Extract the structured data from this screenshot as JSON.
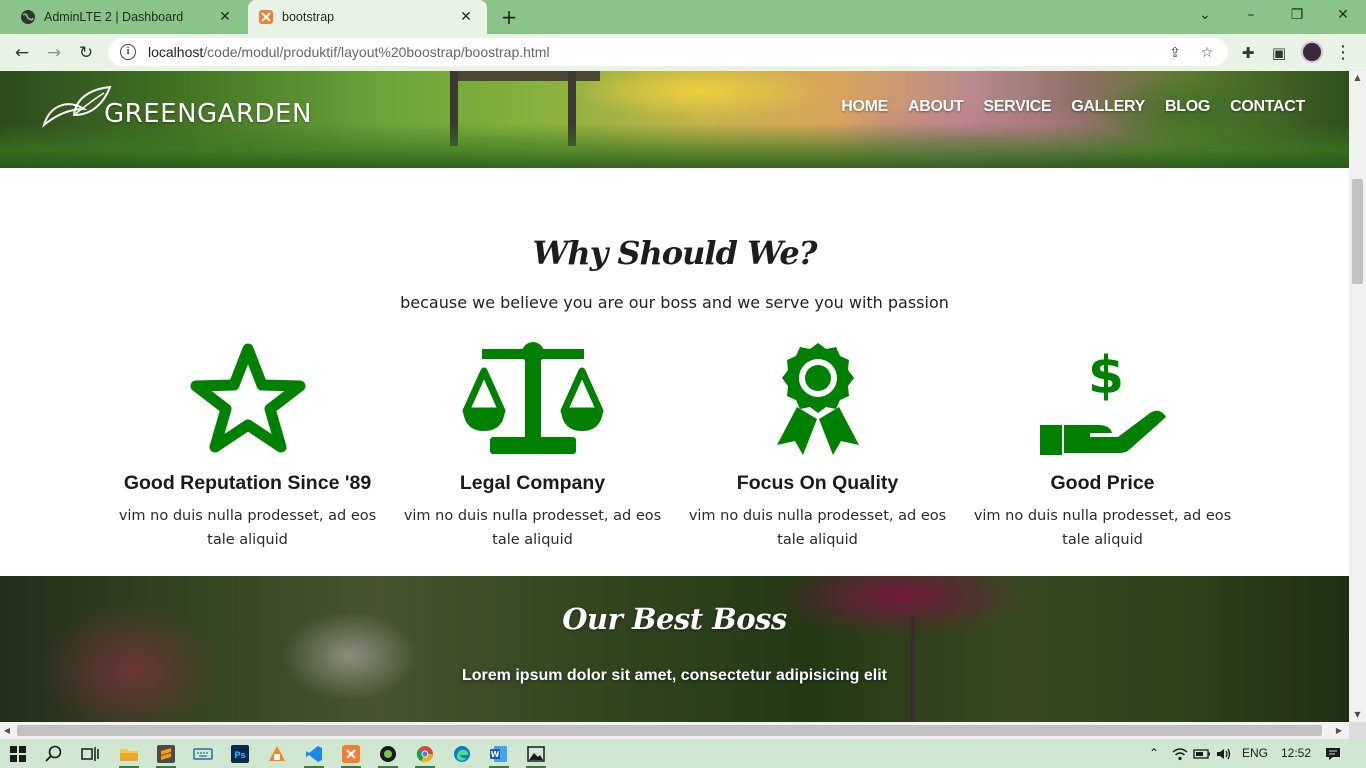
{
  "browser": {
    "tabs": [
      {
        "title": "AdminLTE 2 | Dashboard",
        "icon": "globe-icon",
        "active": false
      },
      {
        "title": "bootstrap",
        "icon": "xampp-icon",
        "active": true
      }
    ],
    "url_host": "localhost",
    "url_path": "/code/modul/produktif/layout%20boostrap/boostrap.html"
  },
  "site": {
    "brand": "GREENGARDEN",
    "nav": [
      "HOME",
      "ABOUT",
      "SERVICE",
      "GALLERY",
      "BLOG",
      "CONTACT"
    ]
  },
  "why": {
    "title": "Why Should We?",
    "subtitle": "because we believe you are our boss and we serve you with passion",
    "accent_color": "#008000",
    "features": [
      {
        "icon": "star-icon",
        "title": "Good Reputation Since '89",
        "text": "vim no duis nulla prodesset, ad eos tale aliquid"
      },
      {
        "icon": "balance-scale-icon",
        "title": "Legal Company",
        "text": "vim no duis nulla prodesset, ad eos tale aliquid"
      },
      {
        "icon": "award-ribbon-icon",
        "title": "Focus On Quality",
        "text": "vim no duis nulla prodesset, ad eos tale aliquid"
      },
      {
        "icon": "hand-dollar-icon",
        "title": "Good Price",
        "text": "vim no duis nulla prodesset, ad eos tale aliquid"
      }
    ]
  },
  "boss": {
    "title": "Our Best Boss",
    "subtitle": "Lorem ipsum dolor sit amet, consectetur adipisicing elit"
  },
  "taskbar": {
    "language": "ENG",
    "time": "12:52"
  }
}
